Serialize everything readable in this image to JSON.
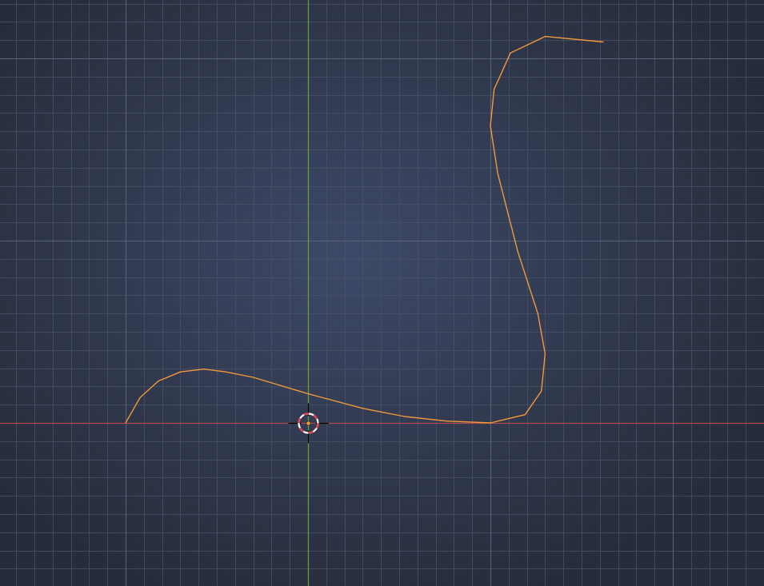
{
  "viewport": {
    "view": "front-orthographic",
    "colors": {
      "background_center": "#3d4968",
      "background_edge": "#272c3a",
      "grid_minor": "#4a5466",
      "grid_major": "#59637a",
      "x_axis": "#b0494d",
      "z_axis": "#6b9c3a",
      "curve": "#f0993a",
      "cursor_red": "#e8404a",
      "cursor_white": "#ffffff",
      "cursor_crosshair": "#000000",
      "origin_dot": "#f0a030"
    },
    "cursor_icon": "3d-cursor-icon",
    "curve_points": [
      [
        -10.0,
        0.0
      ],
      [
        -9.2,
        1.4
      ],
      [
        -8.2,
        2.3
      ],
      [
        -7.0,
        2.8
      ],
      [
        -5.7,
        2.95
      ],
      [
        -4.5,
        2.8
      ],
      [
        -3.0,
        2.5
      ],
      [
        0.0,
        1.6
      ],
      [
        3.0,
        0.8
      ],
      [
        5.3,
        0.35
      ],
      [
        7.6,
        0.1
      ],
      [
        10.0,
        0.0
      ],
      [
        11.9,
        0.45
      ],
      [
        12.8,
        1.75
      ],
      [
        13.0,
        3.8
      ],
      [
        12.6,
        6.0
      ],
      [
        11.5,
        9.4
      ],
      [
        10.4,
        13.7
      ],
      [
        10.0,
        16.3
      ],
      [
        10.2,
        18.3
      ],
      [
        11.1,
        20.3
      ],
      [
        13.0,
        21.2
      ],
      [
        16.2,
        20.9
      ]
    ]
  }
}
